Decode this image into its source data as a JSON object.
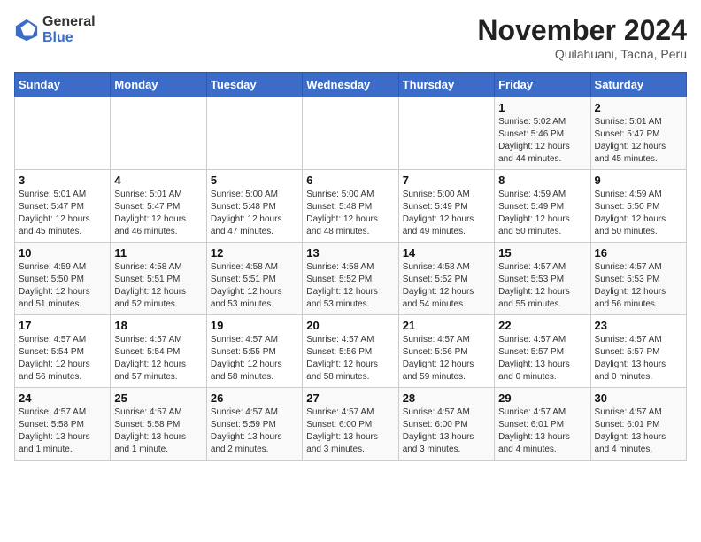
{
  "logo": {
    "general": "General",
    "blue": "Blue"
  },
  "title": "November 2024",
  "subtitle": "Quilahuani, Tacna, Peru",
  "weekdays": [
    "Sunday",
    "Monday",
    "Tuesday",
    "Wednesday",
    "Thursday",
    "Friday",
    "Saturday"
  ],
  "weeks": [
    [
      {
        "day": "",
        "sunrise": "",
        "sunset": "",
        "daylight": ""
      },
      {
        "day": "",
        "sunrise": "",
        "sunset": "",
        "daylight": ""
      },
      {
        "day": "",
        "sunrise": "",
        "sunset": "",
        "daylight": ""
      },
      {
        "day": "",
        "sunrise": "",
        "sunset": "",
        "daylight": ""
      },
      {
        "day": "",
        "sunrise": "",
        "sunset": "",
        "daylight": ""
      },
      {
        "day": "1",
        "sunrise": "Sunrise: 5:02 AM",
        "sunset": "Sunset: 5:46 PM",
        "daylight": "Daylight: 12 hours and 44 minutes."
      },
      {
        "day": "2",
        "sunrise": "Sunrise: 5:01 AM",
        "sunset": "Sunset: 5:47 PM",
        "daylight": "Daylight: 12 hours and 45 minutes."
      }
    ],
    [
      {
        "day": "3",
        "sunrise": "Sunrise: 5:01 AM",
        "sunset": "Sunset: 5:47 PM",
        "daylight": "Daylight: 12 hours and 45 minutes."
      },
      {
        "day": "4",
        "sunrise": "Sunrise: 5:01 AM",
        "sunset": "Sunset: 5:47 PM",
        "daylight": "Daylight: 12 hours and 46 minutes."
      },
      {
        "day": "5",
        "sunrise": "Sunrise: 5:00 AM",
        "sunset": "Sunset: 5:48 PM",
        "daylight": "Daylight: 12 hours and 47 minutes."
      },
      {
        "day": "6",
        "sunrise": "Sunrise: 5:00 AM",
        "sunset": "Sunset: 5:48 PM",
        "daylight": "Daylight: 12 hours and 48 minutes."
      },
      {
        "day": "7",
        "sunrise": "Sunrise: 5:00 AM",
        "sunset": "Sunset: 5:49 PM",
        "daylight": "Daylight: 12 hours and 49 minutes."
      },
      {
        "day": "8",
        "sunrise": "Sunrise: 4:59 AM",
        "sunset": "Sunset: 5:49 PM",
        "daylight": "Daylight: 12 hours and 50 minutes."
      },
      {
        "day": "9",
        "sunrise": "Sunrise: 4:59 AM",
        "sunset": "Sunset: 5:50 PM",
        "daylight": "Daylight: 12 hours and 50 minutes."
      }
    ],
    [
      {
        "day": "10",
        "sunrise": "Sunrise: 4:59 AM",
        "sunset": "Sunset: 5:50 PM",
        "daylight": "Daylight: 12 hours and 51 minutes."
      },
      {
        "day": "11",
        "sunrise": "Sunrise: 4:58 AM",
        "sunset": "Sunset: 5:51 PM",
        "daylight": "Daylight: 12 hours and 52 minutes."
      },
      {
        "day": "12",
        "sunrise": "Sunrise: 4:58 AM",
        "sunset": "Sunset: 5:51 PM",
        "daylight": "Daylight: 12 hours and 53 minutes."
      },
      {
        "day": "13",
        "sunrise": "Sunrise: 4:58 AM",
        "sunset": "Sunset: 5:52 PM",
        "daylight": "Daylight: 12 hours and 53 minutes."
      },
      {
        "day": "14",
        "sunrise": "Sunrise: 4:58 AM",
        "sunset": "Sunset: 5:52 PM",
        "daylight": "Daylight: 12 hours and 54 minutes."
      },
      {
        "day": "15",
        "sunrise": "Sunrise: 4:57 AM",
        "sunset": "Sunset: 5:53 PM",
        "daylight": "Daylight: 12 hours and 55 minutes."
      },
      {
        "day": "16",
        "sunrise": "Sunrise: 4:57 AM",
        "sunset": "Sunset: 5:53 PM",
        "daylight": "Daylight: 12 hours and 56 minutes."
      }
    ],
    [
      {
        "day": "17",
        "sunrise": "Sunrise: 4:57 AM",
        "sunset": "Sunset: 5:54 PM",
        "daylight": "Daylight: 12 hours and 56 minutes."
      },
      {
        "day": "18",
        "sunrise": "Sunrise: 4:57 AM",
        "sunset": "Sunset: 5:54 PM",
        "daylight": "Daylight: 12 hours and 57 minutes."
      },
      {
        "day": "19",
        "sunrise": "Sunrise: 4:57 AM",
        "sunset": "Sunset: 5:55 PM",
        "daylight": "Daylight: 12 hours and 58 minutes."
      },
      {
        "day": "20",
        "sunrise": "Sunrise: 4:57 AM",
        "sunset": "Sunset: 5:56 PM",
        "daylight": "Daylight: 12 hours and 58 minutes."
      },
      {
        "day": "21",
        "sunrise": "Sunrise: 4:57 AM",
        "sunset": "Sunset: 5:56 PM",
        "daylight": "Daylight: 12 hours and 59 minutes."
      },
      {
        "day": "22",
        "sunrise": "Sunrise: 4:57 AM",
        "sunset": "Sunset: 5:57 PM",
        "daylight": "Daylight: 13 hours and 0 minutes."
      },
      {
        "day": "23",
        "sunrise": "Sunrise: 4:57 AM",
        "sunset": "Sunset: 5:57 PM",
        "daylight": "Daylight: 13 hours and 0 minutes."
      }
    ],
    [
      {
        "day": "24",
        "sunrise": "Sunrise: 4:57 AM",
        "sunset": "Sunset: 5:58 PM",
        "daylight": "Daylight: 13 hours and 1 minute."
      },
      {
        "day": "25",
        "sunrise": "Sunrise: 4:57 AM",
        "sunset": "Sunset: 5:58 PM",
        "daylight": "Daylight: 13 hours and 1 minute."
      },
      {
        "day": "26",
        "sunrise": "Sunrise: 4:57 AM",
        "sunset": "Sunset: 5:59 PM",
        "daylight": "Daylight: 13 hours and 2 minutes."
      },
      {
        "day": "27",
        "sunrise": "Sunrise: 4:57 AM",
        "sunset": "Sunset: 6:00 PM",
        "daylight": "Daylight: 13 hours and 3 minutes."
      },
      {
        "day": "28",
        "sunrise": "Sunrise: 4:57 AM",
        "sunset": "Sunset: 6:00 PM",
        "daylight": "Daylight: 13 hours and 3 minutes."
      },
      {
        "day": "29",
        "sunrise": "Sunrise: 4:57 AM",
        "sunset": "Sunset: 6:01 PM",
        "daylight": "Daylight: 13 hours and 4 minutes."
      },
      {
        "day": "30",
        "sunrise": "Sunrise: 4:57 AM",
        "sunset": "Sunset: 6:01 PM",
        "daylight": "Daylight: 13 hours and 4 minutes."
      }
    ]
  ]
}
